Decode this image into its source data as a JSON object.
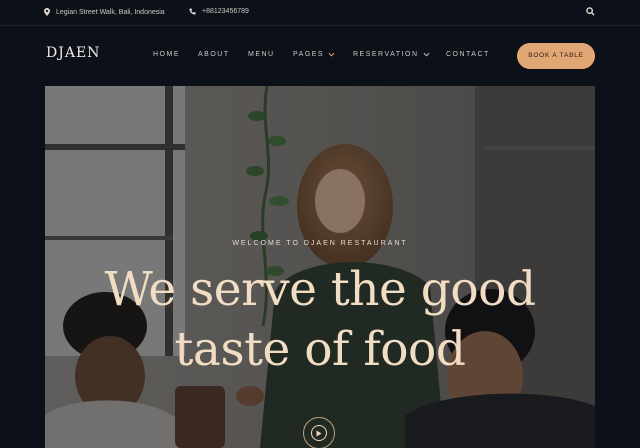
{
  "topbar": {
    "address": "Legian Street Walk, Bali, Indonesia",
    "phone": "+88123456789",
    "location_icon": "map-pin-icon",
    "phone_icon": "phone-icon",
    "search_icon": "search-icon"
  },
  "navbar": {
    "logo": "DJAEN",
    "items": [
      {
        "label": "HOME"
      },
      {
        "label": "ABOUT"
      },
      {
        "label": "MENU"
      },
      {
        "label": "PAGES"
      },
      {
        "label": "RESERVATION"
      },
      {
        "label": "CONTACT"
      }
    ],
    "cta_label": "BOOK A TABLE"
  },
  "hero": {
    "eyebrow": "WELCOME TO DJAEN RESTAURANT",
    "title_line1": "We serve the good",
    "title_line2": "taste of food",
    "play_icon": "play-icon"
  },
  "colors": {
    "background": "#0b1019",
    "accent": "#e0a775",
    "headline": "#f1dcc4"
  }
}
